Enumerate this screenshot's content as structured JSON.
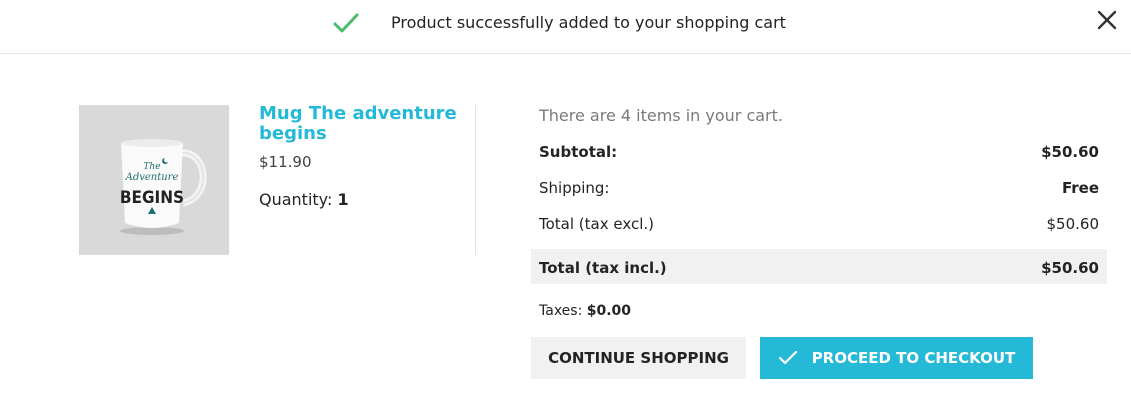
{
  "header": {
    "title": "Product successfully added to your shopping cart",
    "icons": {
      "success": "check-icon",
      "close": "close-icon"
    },
    "success_color": "#4cbb6c"
  },
  "product": {
    "name": "Mug The adventure begins",
    "price": "$11.90",
    "quantity_label": "Quantity:",
    "quantity_value": "1",
    "image_text": {
      "line1": "The",
      "line2": "Adventure",
      "line3": "BEGINS"
    }
  },
  "cart": {
    "count_text": "There are 4 items in your cart.",
    "subtotal_label": "Subtotal:",
    "subtotal_value": "$50.60",
    "shipping_label": "Shipping:",
    "shipping_value": "Free",
    "total_excl_label": "Total (tax excl.)",
    "total_excl_value": "$50.60",
    "total_incl_label": "Total (tax incl.)",
    "total_incl_value": "$50.60",
    "taxes_label": "Taxes:",
    "taxes_value": "$0.00"
  },
  "actions": {
    "continue_label": "CONTINUE SHOPPING",
    "checkout_label": "PROCEED TO CHECKOUT"
  },
  "colors": {
    "accent": "#24b9d7",
    "band": "#f1f1f1",
    "muted": "#7a7a7a"
  }
}
